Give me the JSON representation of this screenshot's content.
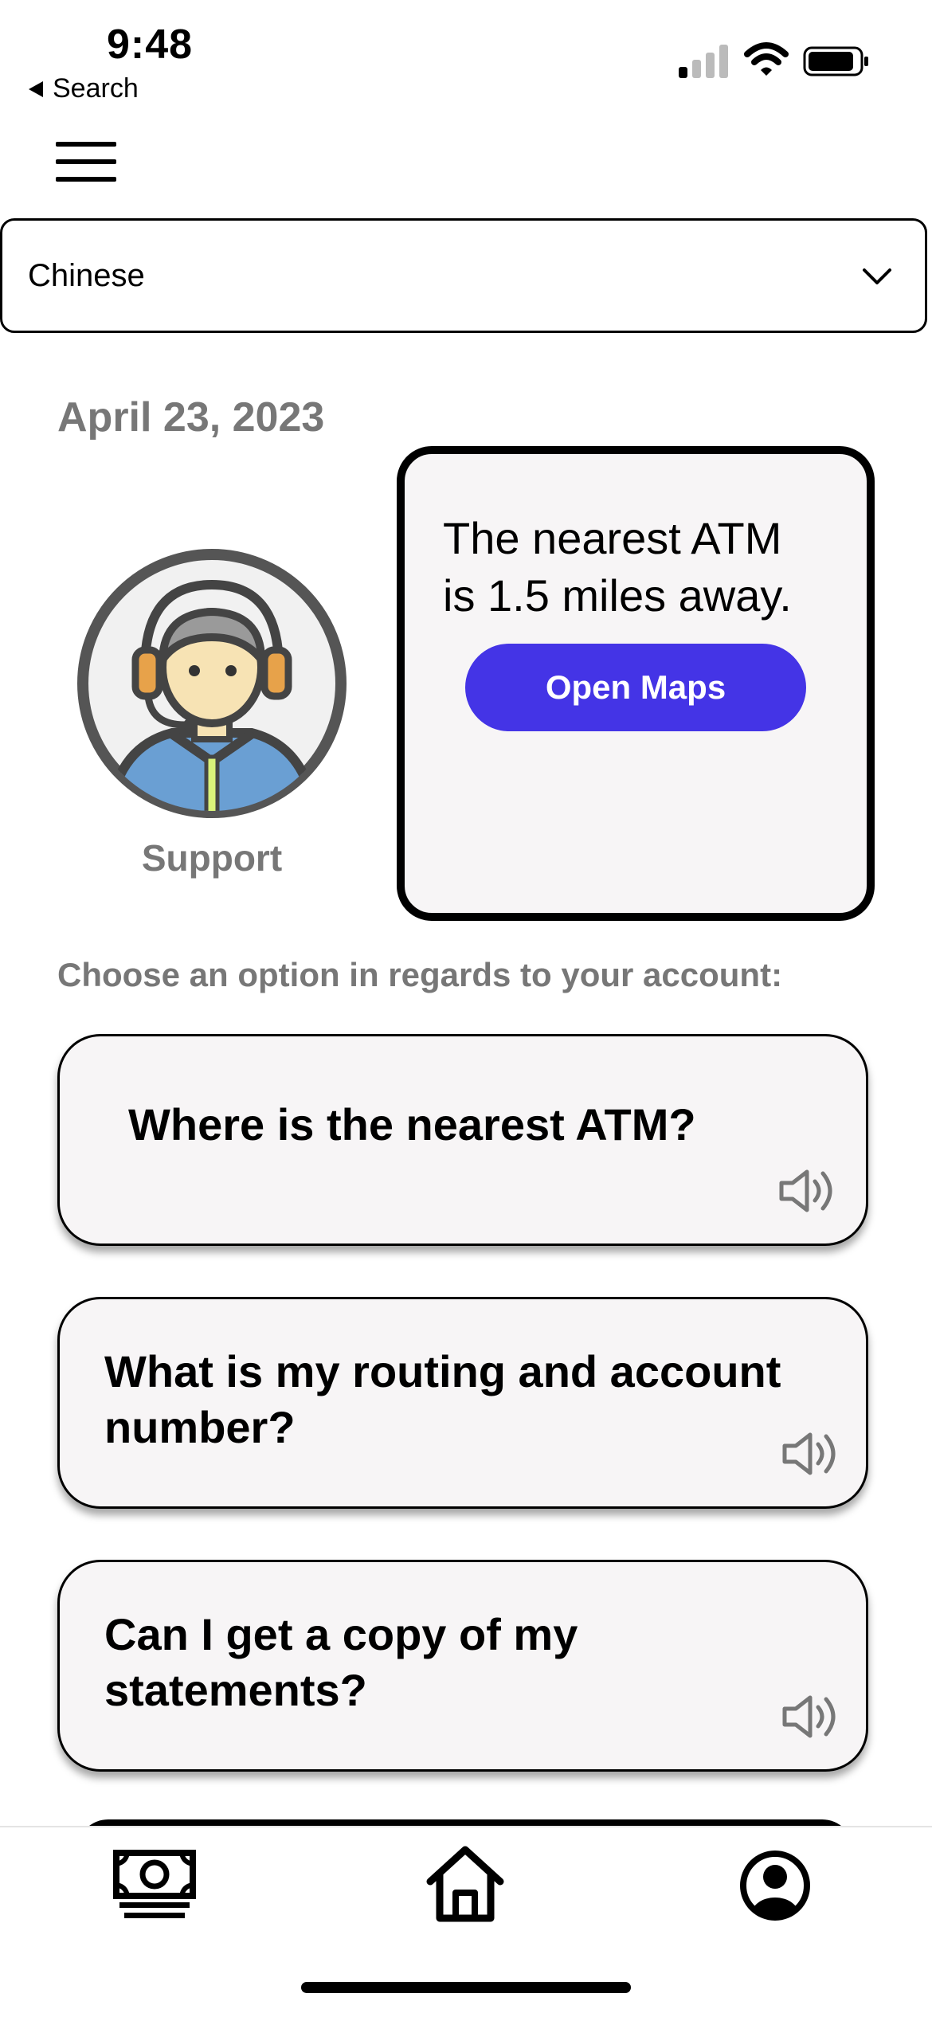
{
  "status_bar": {
    "time": "9:48",
    "back_label": "Search",
    "icons": [
      "signal-icon",
      "wifi-icon",
      "battery-icon"
    ]
  },
  "header": {
    "menu_icon": "hamburger-menu-icon"
  },
  "language_select": {
    "selected": "Chinese"
  },
  "date": "April 23, 2023",
  "support": {
    "label": "Support",
    "avatar_icon": "support-agent-headset-icon"
  },
  "atm_card": {
    "message_line1": "The nearest ATM",
    "message_line2": "is 1.5 miles away.",
    "button_label": "Open Maps",
    "button_color": "#4434e6"
  },
  "options_prompt": "Choose an option in regards to your account:",
  "options": [
    {
      "line1": "Where is the nearest ATM?",
      "line2": "",
      "icon": "speaker-icon"
    },
    {
      "line1": "What is my routing and account",
      "line2": "number?",
      "icon": "speaker-icon"
    },
    {
      "line1": "Can I get a copy of my",
      "line2": "statements?",
      "icon": "speaker-icon"
    }
  ],
  "bottom_nav": {
    "items": [
      {
        "icon": "money-icon"
      },
      {
        "icon": "home-icon"
      },
      {
        "icon": "profile-icon"
      }
    ]
  },
  "colors": {
    "accent": "#4434e6",
    "muted_text": "#777777",
    "card_bg": "#f7f5f6"
  }
}
